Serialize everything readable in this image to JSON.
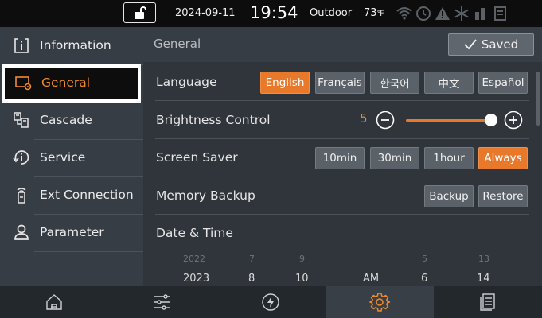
{
  "status_bar": {
    "date": "2024-09-11",
    "time": "19:54",
    "outdoor_label": "Outdoor",
    "outdoor_temp": "73",
    "temp_unit": "℉",
    "icons": [
      "lock-open-icon",
      "wifi-icon",
      "clock-icon",
      "warning-icon",
      "snowflake-icon",
      "signal-icon",
      "document-icon"
    ]
  },
  "sidebar": {
    "items": [
      {
        "label": "Information",
        "icon": "info-icon",
        "active": false
      },
      {
        "label": "General",
        "icon": "general-settings-icon",
        "active": true
      },
      {
        "label": "Cascade",
        "icon": "cascade-icon",
        "active": false
      },
      {
        "label": "Service",
        "icon": "service-icon",
        "active": false
      },
      {
        "label": "Ext Connection",
        "icon": "ext-connection-icon",
        "active": false
      },
      {
        "label": "Parameter",
        "icon": "user-icon",
        "active": false
      }
    ]
  },
  "main": {
    "title": "General",
    "saved_label": "Saved",
    "language": {
      "label": "Language",
      "options": [
        "English",
        "Français",
        "한국어",
        "中文",
        "Español"
      ],
      "selected": "English"
    },
    "brightness": {
      "label": "Brightness Control",
      "value": "5",
      "level_fraction": 1.0
    },
    "screen_saver": {
      "label": "Screen Saver",
      "options": [
        "10min",
        "30min",
        "1hour",
        "Always"
      ],
      "selected": "Always"
    },
    "memory_backup": {
      "label": "Memory Backup",
      "backup_label": "Backup",
      "restore_label": "Restore"
    },
    "date_time": {
      "label": "Date & Time",
      "prev": {
        "year": "2022",
        "month": "7",
        "day": "9",
        "hour": "5",
        "minute": "13"
      },
      "current": {
        "year": "2023",
        "month": "8",
        "day": "10",
        "ampm": "AM",
        "hour": "6",
        "minute": "14"
      }
    }
  },
  "bottom_nav": {
    "items": [
      "home-icon",
      "sliders-icon",
      "power-icon",
      "gear-icon",
      "document-list-icon"
    ],
    "active": "gear-icon"
  },
  "colors": {
    "accent": "#e8782a",
    "accent_text": "#f08a2c"
  }
}
